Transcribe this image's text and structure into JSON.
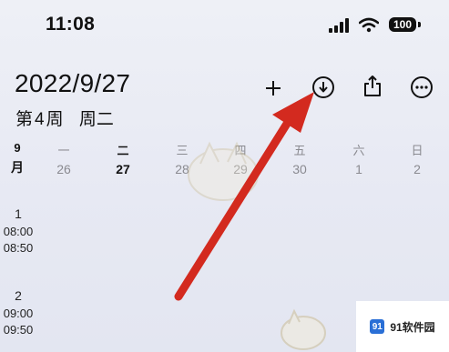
{
  "status_bar": {
    "time": "11:08",
    "battery": "100"
  },
  "header": {
    "date": "2022/9/27",
    "week_prefix": "第",
    "week_number": "4",
    "week_suffix": "周",
    "weekday": "周二"
  },
  "toolbar": {
    "add_icon": "plus-icon",
    "download_icon": "download-icon",
    "share_icon": "share-icon",
    "more_icon": "more-icon"
  },
  "week_strip": {
    "month_number": "9",
    "month_suffix": "月",
    "days": [
      {
        "weekday": "一",
        "date": "26"
      },
      {
        "weekday": "二",
        "date": "27"
      },
      {
        "weekday": "三",
        "date": "28"
      },
      {
        "weekday": "四",
        "date": "29"
      },
      {
        "weekday": "五",
        "date": "30"
      },
      {
        "weekday": "六",
        "date": "1"
      },
      {
        "weekday": "日",
        "date": "2"
      }
    ]
  },
  "periods": [
    {
      "index": "1",
      "start": "08:00",
      "end": "08:50"
    },
    {
      "index": "2",
      "start": "09:00",
      "end": "09:50"
    }
  ],
  "watermark": {
    "text": "91软件园",
    "logo": "91"
  },
  "colors": {
    "arrow": "#d32a1f",
    "accent": "#111111"
  }
}
